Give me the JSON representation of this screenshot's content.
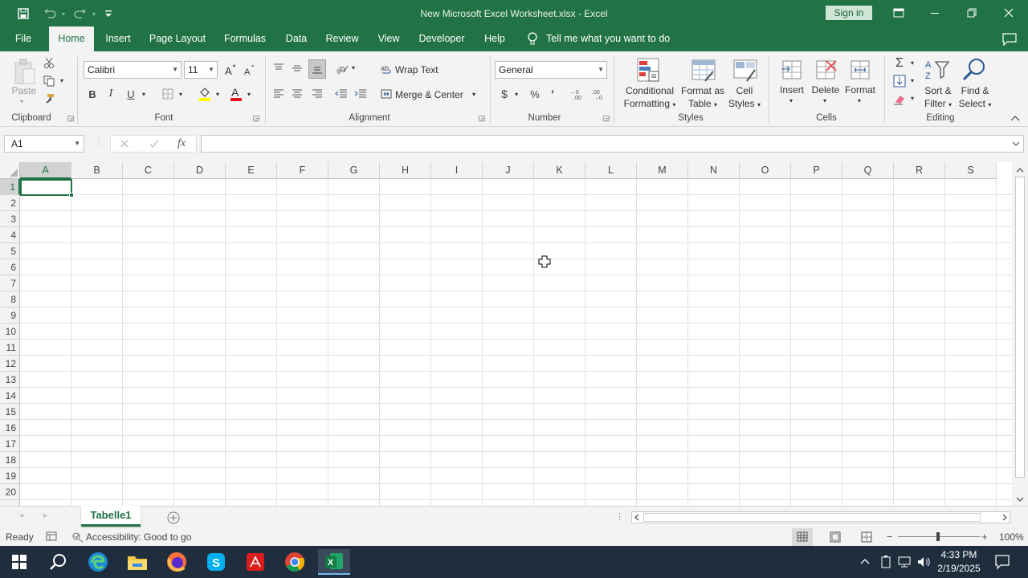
{
  "titlebar": {
    "title": "New Microsoft Excel Worksheet.xlsx  -  Excel",
    "signin": "Sign in"
  },
  "menu": {
    "tabs": [
      "File",
      "Home",
      "Insert",
      "Page Layout",
      "Formulas",
      "Data",
      "Review",
      "View",
      "Developer",
      "Help"
    ],
    "active": "Home",
    "tell_me": "Tell me what you want to do"
  },
  "ribbon": {
    "clipboard": {
      "label": "Clipboard",
      "paste": "Paste"
    },
    "font": {
      "label": "Font",
      "name": "Calibri",
      "size": "11",
      "bold": "B",
      "italic": "I",
      "underline": "U"
    },
    "alignment": {
      "label": "Alignment",
      "wrap_text": "Wrap Text",
      "merge_center": "Merge & Center"
    },
    "number": {
      "label": "Number",
      "format": "General",
      "currency": "$",
      "percent": "%",
      "comma": "’"
    },
    "styles": {
      "label": "Styles",
      "conditional": [
        "Conditional",
        "Formatting"
      ],
      "format_table": [
        "Format as",
        "Table"
      ],
      "cell_styles": [
        "Cell",
        "Styles"
      ]
    },
    "cells": {
      "label": "Cells",
      "insert": "Insert",
      "delete": "Delete",
      "format": "Format"
    },
    "editing": {
      "label": "Editing",
      "sort_filter": [
        "Sort &",
        "Filter"
      ],
      "find_select": [
        "Find &",
        "Select"
      ]
    }
  },
  "formula_bar": {
    "name_box": "A1",
    "fx": "fx",
    "value": ""
  },
  "grid": {
    "columns": [
      "A",
      "B",
      "C",
      "D",
      "E",
      "F",
      "G",
      "H",
      "I",
      "J",
      "K",
      "L",
      "M",
      "N",
      "O",
      "P",
      "Q",
      "R",
      "S"
    ],
    "rows": [
      "1",
      "2",
      "3",
      "4",
      "5",
      "6",
      "7",
      "8",
      "9",
      "10",
      "11",
      "12",
      "13",
      "14",
      "15",
      "16",
      "17",
      "18",
      "19",
      "20"
    ],
    "selected_cell": "A1"
  },
  "sheets": {
    "tabs": [
      "Tabelle1"
    ],
    "active": "Tabelle1"
  },
  "status": {
    "ready": "Ready",
    "accessibility": "Accessibility: Good to go",
    "zoom": "100%"
  },
  "taskbar": {
    "time": "4:33 PM",
    "date": "2/19/2025"
  },
  "colors": {
    "excel_green": "#217346",
    "ribbon_bg": "#f3f3f3",
    "taskbar_bg": "#1f2d3d"
  }
}
